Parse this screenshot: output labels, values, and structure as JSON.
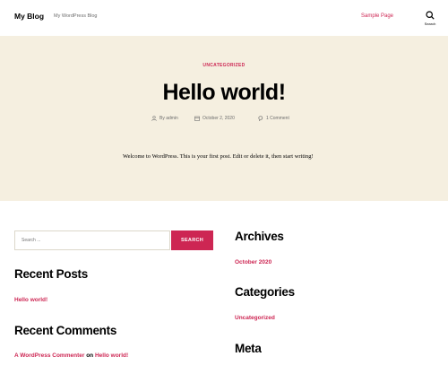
{
  "header": {
    "site_title": "My Blog",
    "site_description": "My WordPress Blog",
    "nav_sample_page": "Sample Page",
    "search_toggle_label": "Search"
  },
  "post": {
    "category": "UNCATEGORIZED",
    "title": "Hello world!",
    "author": "By admin",
    "date": "October 2, 2020",
    "comments": "1 Comment",
    "content": "Welcome to WordPress. This is your first post. Edit or delete it, then start writing!"
  },
  "widgets": {
    "search_placeholder": "Search ...",
    "search_button": "SEARCH",
    "recent_posts_title": "Recent Posts",
    "recent_posts": [
      "Hello world!"
    ],
    "recent_comments_title": "Recent Comments",
    "recent_comment": {
      "author": "A WordPress Commenter",
      "connector": " on ",
      "post": "Hello world!"
    },
    "archives_title": "Archives",
    "archives": [
      "October 2020"
    ],
    "categories_title": "Categories",
    "categories": [
      "Uncategorized"
    ],
    "meta_title": "Meta"
  },
  "colors": {
    "accent": "#cd2653",
    "hero_background": "#f5efe0",
    "text": "#000000",
    "muted": "#6d6d6d"
  },
  "icons": {
    "search_toggle": "search-icon",
    "author": "user-icon",
    "date": "calendar-icon",
    "comments": "comment-icon"
  }
}
